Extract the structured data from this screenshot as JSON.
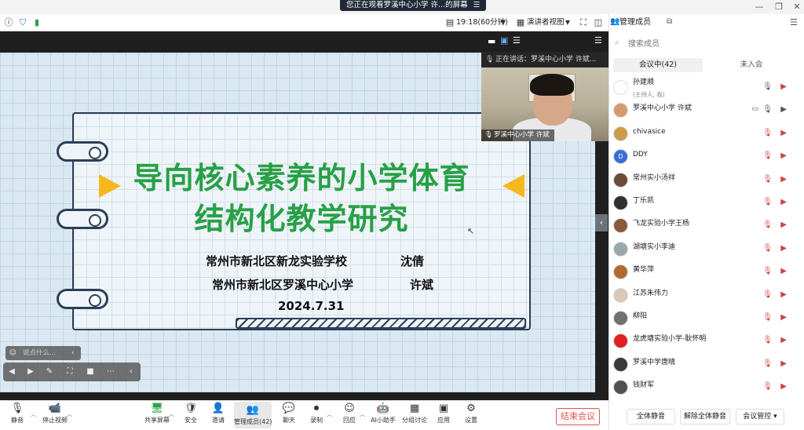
{
  "window": {
    "share_banner": "您正在观看罗溪中心小学 许...的屏幕",
    "banner_menu": "☰",
    "controls": [
      "—",
      "❐",
      "✕"
    ]
  },
  "topbar": {
    "info_icon": "info-icon",
    "shield_icon": "shield-icon",
    "signal_icon": "signal-icon",
    "clock_text": "19:18(60分钟)",
    "view_mode": "演讲者视图",
    "manage_members": "管理成员"
  },
  "slide": {
    "title_line1": "导向核心素养的小学体育",
    "title_line2": "结构化教学研究",
    "school1": "常州市新北区新龙实验学校",
    "person1": "沈倩",
    "school2": "常州市新北区罗溪中心小学",
    "person2": "许斌",
    "date": "2024.7.31",
    "colors": {
      "title": "#27a046",
      "accent": "#f5b81e",
      "ink": "#2c3e58"
    }
  },
  "video": {
    "speaking_label": "正在讲话：罗溪中心小学 许斌...",
    "name_tag": "罗溪中心小学 许斌"
  },
  "comment": {
    "placeholder": "说点什么..."
  },
  "bottombar": {
    "items": [
      {
        "label": "静音",
        "icon": "🎙"
      },
      {
        "label": "停止视频",
        "icon": "📹"
      },
      {
        "label": "共享屏幕",
        "icon": "🖥"
      },
      {
        "label": "安全",
        "icon": "🛡"
      },
      {
        "label": "邀请",
        "icon": "👤"
      },
      {
        "label": "管理成员(42)",
        "icon": "👥"
      },
      {
        "label": "聊天",
        "icon": "💬"
      },
      {
        "label": "录制",
        "icon": "⏺"
      },
      {
        "label": "回应",
        "icon": "☺"
      },
      {
        "label": "AI小助手",
        "icon": "🤖"
      },
      {
        "label": "分组讨论",
        "icon": "▦"
      },
      {
        "label": "应用",
        "icon": "▣"
      },
      {
        "label": "设置",
        "icon": "⚙"
      }
    ],
    "end_meeting": "结束会议"
  },
  "panel": {
    "title": "管理成员",
    "search_placeholder": "搜索成员",
    "tab_in_meeting": "会议中(42)",
    "tab_not_joined": "未入会",
    "members": [
      {
        "name": "孙建顺",
        "host": "(主持人, 我)",
        "avatar_color": "#ffffff",
        "mic": "on",
        "cam": "off"
      },
      {
        "name": "罗溪中心小学 许斌",
        "avatar_color": "#d59b6d",
        "mic": "on",
        "cam": "on",
        "sharing": true
      },
      {
        "name": "chivasice",
        "avatar_color": "#c89c4a",
        "mic": "off",
        "cam": "off"
      },
      {
        "name": "DDY",
        "avatar_color": "#3a6ed6",
        "avatar_text": "D",
        "mic": "off",
        "cam": "off"
      },
      {
        "name": "常州实小汤祥",
        "avatar_color": "#6b4a3a",
        "mic": "off",
        "cam": "off"
      },
      {
        "name": "丁乐凯",
        "avatar_color": "#303030",
        "mic": "off",
        "cam": "off"
      },
      {
        "name": "飞龙实验小学王杨",
        "avatar_color": "#8a5a3a",
        "mic": "off",
        "cam": "off"
      },
      {
        "name": "湖塘实小李迪",
        "avatar_color": "#9aa7b0",
        "mic": "off",
        "cam": "off"
      },
      {
        "name": "黄华萍",
        "avatar_color": "#b06a30",
        "mic": "off",
        "cam": "off"
      },
      {
        "name": "江苏朱伟力",
        "avatar_color": "#d8c8b8",
        "mic": "off",
        "cam": "off"
      },
      {
        "name": "柳阳",
        "avatar_color": "#707070",
        "mic": "off",
        "cam": "off"
      },
      {
        "name": "龙虎塘实验小学-耿怀明",
        "avatar_color": "#e02020",
        "mic": "off",
        "cam": "off"
      },
      {
        "name": "罗溪中学唐晴",
        "avatar_color": "#3a3a3a",
        "mic": "off",
        "cam": "off"
      },
      {
        "name": "钱财军",
        "avatar_color": "#505050",
        "mic": "off",
        "cam": "off"
      }
    ],
    "mute_all": "全体静音",
    "unmute_all": "解除全体静音",
    "meeting_control": "会议管控 ▾"
  }
}
